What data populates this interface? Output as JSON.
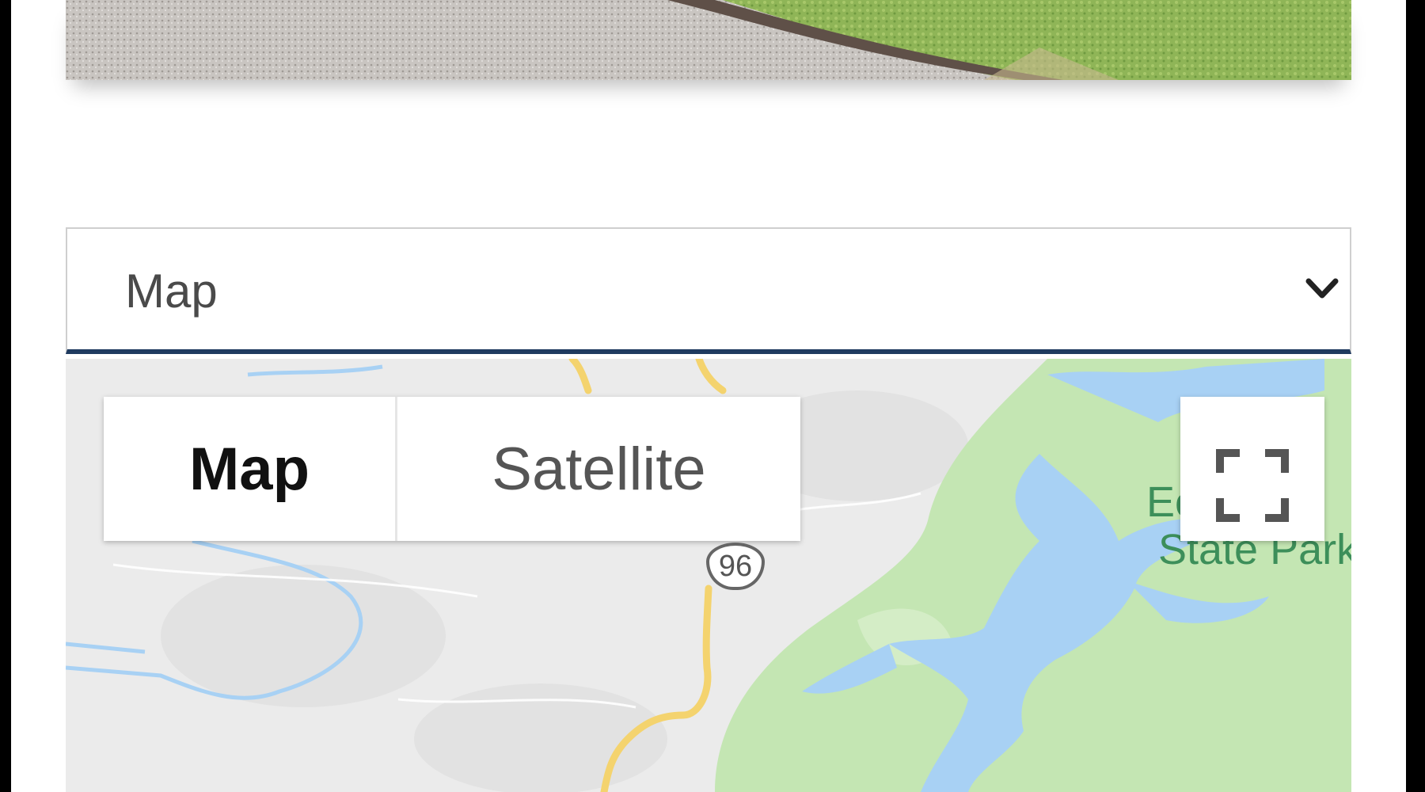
{
  "dropdown": {
    "selected": "Map"
  },
  "map": {
    "type_control": {
      "map_label": "Map",
      "satellite_label": "Satellite"
    },
    "route_shield": "96",
    "park_label_line1": "Ec    in",
    "park_label_line2": "State Park"
  },
  "colors": {
    "select_underline": "#1f3a5f",
    "water": "#a8d1f4",
    "park_green": "#c4e6b3",
    "road": "#f4d36e",
    "park_label": "#3d8f5a"
  },
  "icons": {
    "dropdown": "chevron-down-icon",
    "fullscreen": "fullscreen-icon"
  }
}
